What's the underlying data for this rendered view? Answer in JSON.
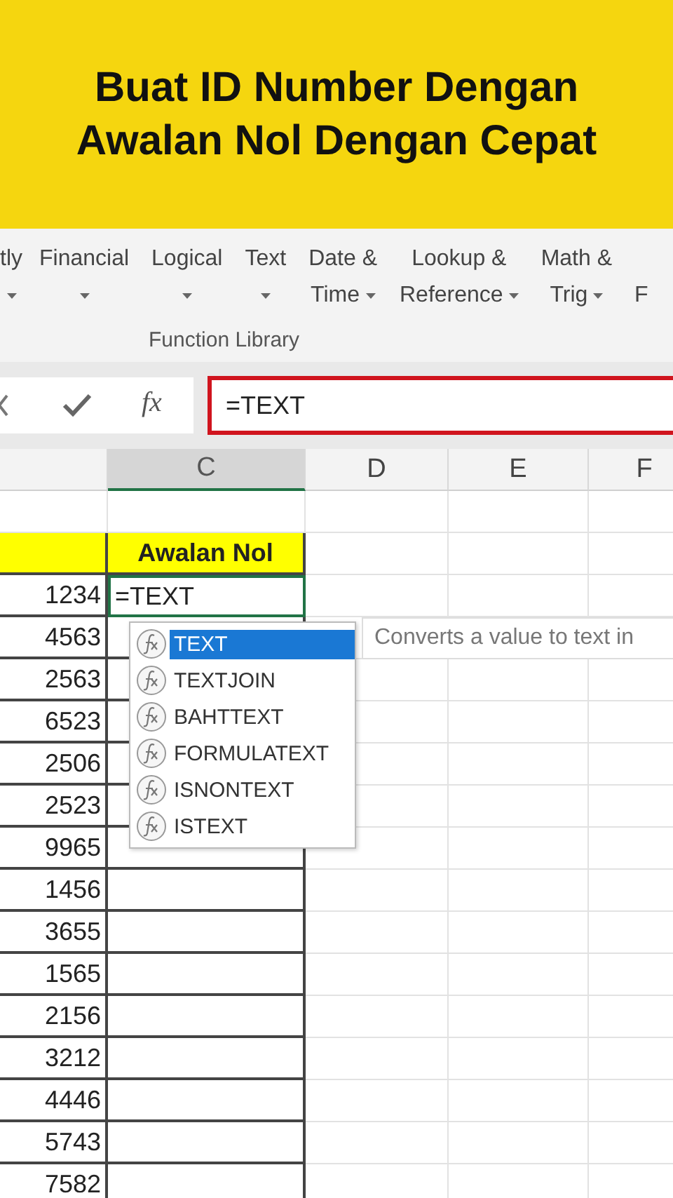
{
  "banner": {
    "title_lines": [
      "Buat ID Number Dengan",
      "Awalan Nol Dengan Cepat"
    ]
  },
  "ribbon": {
    "items": [
      {
        "line1": "tly",
        "caret": true
      },
      {
        "line1": "Financial",
        "caret": true
      },
      {
        "line1": "Logical",
        "caret": true
      },
      {
        "line1": "Text",
        "caret": true
      },
      {
        "line1": "Date &",
        "line2": "Time",
        "caret": true
      },
      {
        "line1": "Lookup &",
        "line2": "Reference",
        "caret": true
      },
      {
        "line1": "Math &",
        "line2": "Trig",
        "caret": true
      },
      {
        "line2": "F",
        "caret": false
      }
    ],
    "group_label": "Function Library"
  },
  "formula_bar": {
    "fx_label": "fx",
    "value": "=TEXT",
    "highlighted": true
  },
  "sheet": {
    "columns": [
      {
        "label": "C",
        "selected": true
      },
      {
        "label": "D",
        "selected": false
      },
      {
        "label": "E",
        "selected": false
      },
      {
        "label": "F",
        "selected": false
      }
    ],
    "rows": [
      {
        "kind": "blank"
      },
      {
        "kind": "header",
        "column_c": "Awalan Nol"
      },
      {
        "kind": "data",
        "column_b": "1234",
        "column_c": "=TEXT",
        "active": true
      },
      {
        "kind": "data",
        "column_b": "4563",
        "active": false
      },
      {
        "kind": "data",
        "column_b": "2563",
        "active": false
      },
      {
        "kind": "data",
        "column_b": "6523",
        "active": false
      },
      {
        "kind": "data",
        "column_b": "2506",
        "active": false
      },
      {
        "kind": "data",
        "column_b": "2523",
        "active": false
      },
      {
        "kind": "data",
        "column_b": "9965",
        "active": false
      },
      {
        "kind": "data",
        "column_b": "1456",
        "active": false
      },
      {
        "kind": "data",
        "column_b": "3655",
        "active": false
      },
      {
        "kind": "data",
        "column_b": "1565",
        "active": false
      },
      {
        "kind": "data",
        "column_b": "2156",
        "active": false
      },
      {
        "kind": "data",
        "column_b": "3212",
        "active": false
      },
      {
        "kind": "data",
        "column_b": "4446",
        "active": false
      },
      {
        "kind": "data",
        "column_b": "5743",
        "active": false
      },
      {
        "kind": "data",
        "column_b": "7582",
        "active": false
      }
    ]
  },
  "autocomplete": {
    "items": [
      {
        "label": "TEXT",
        "selected": true
      },
      {
        "label": "TEXTJOIN",
        "selected": false
      },
      {
        "label": "BAHTTEXT",
        "selected": false
      },
      {
        "label": "FORMULATEXT",
        "selected": false
      },
      {
        "label": "ISNONTEXT",
        "selected": false
      },
      {
        "label": "ISTEXT",
        "selected": false
      }
    ],
    "tooltip": "Converts a value to text in"
  }
}
